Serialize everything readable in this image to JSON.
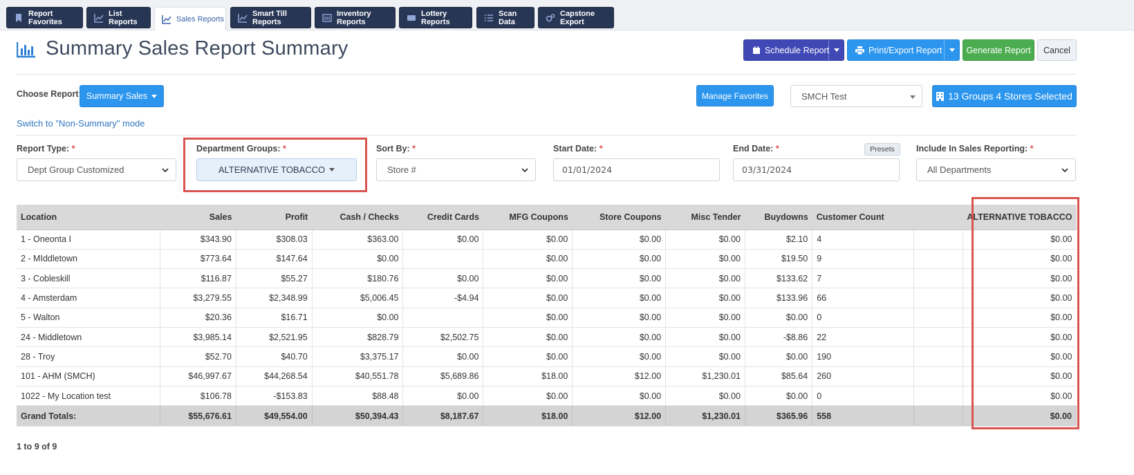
{
  "tabs": [
    {
      "label": "Report Favorites",
      "icon": "bookmark-icon",
      "active": false
    },
    {
      "label": "List Reports",
      "icon": "line-chart-icon",
      "active": false
    },
    {
      "label": "Sales Reports",
      "icon": "line-chart-icon",
      "active": true
    },
    {
      "label": "Smart Till Reports",
      "icon": "line-chart-icon",
      "active": false
    },
    {
      "label": "Inventory Reports",
      "icon": "inventory-icon",
      "active": false
    },
    {
      "label": "Lottery Reports",
      "icon": "ticket-icon",
      "active": false
    },
    {
      "label": "Scan Data",
      "icon": "list-icon",
      "active": false
    },
    {
      "label": "Capstone Export",
      "icon": "cogs-icon",
      "active": false
    }
  ],
  "header": {
    "title": "Summary Sales Report Summary",
    "icon": "bar-chart-icon",
    "schedule_label": "Schedule Report",
    "print_label": "Print/Export Report",
    "generate_label": "Generate Report",
    "cancel_label": "Cancel"
  },
  "controls": {
    "choose_report_label": "Choose Report",
    "choose_report_value": "Summary Sales",
    "switch_mode_link": "Switch to \"Non-Summary\" mode",
    "manage_favorites_label": "Manage Favorites",
    "store_select_value": "SMCH Test",
    "stores_selected_label": "13 Groups 4 Stores Selected"
  },
  "filters": {
    "report_type_label": "Report Type:",
    "report_type_value": "Dept Group Customized",
    "dept_groups_label": "Department Groups:",
    "dept_groups_value": "ALTERNATIVE TOBACCO",
    "sort_by_label": "Sort By:",
    "sort_by_value": "Store #",
    "start_date_label": "Start Date:",
    "start_date_value": "01/01/2024",
    "end_date_label": "End Date:",
    "end_date_value": "03/31/2024",
    "presets_label": "Presets",
    "include_label": "Include In Sales Reporting:",
    "include_value": "All Departments",
    "required_mark": "*"
  },
  "table": {
    "headers": [
      "Location",
      "Sales",
      "Profit",
      "Cash / Checks",
      "Credit Cards",
      "MFG Coupons",
      "Store Coupons",
      "Misc Tender",
      "Buydowns",
      "Customer Count",
      "",
      "ALTERNATIVE TOBACCO"
    ],
    "rows": [
      [
        "1 - Oneonta I",
        "$343.90",
        "$308.03",
        "$363.00",
        "$0.00",
        "$0.00",
        "$0.00",
        "$0.00",
        "$2.10",
        "4",
        "",
        "$0.00"
      ],
      [
        "2 - MIddletown",
        "$773.64",
        "$147.64",
        "$0.00",
        "",
        "$0.00",
        "$0.00",
        "$0.00",
        "$19.50",
        "9",
        "",
        "$0.00"
      ],
      [
        "3 - Cobleskill",
        "$116.87",
        "$55.27",
        "$180.76",
        "$0.00",
        "$0.00",
        "$0.00",
        "$0.00",
        "$133.62",
        "7",
        "",
        "$0.00"
      ],
      [
        "4 - Amsterdam",
        "$3,279.55",
        "$2,348.99",
        "$5,006.45",
        "-$4.94",
        "$0.00",
        "$0.00",
        "$0.00",
        "$133.96",
        "66",
        "",
        "$0.00"
      ],
      [
        "5 - Walton",
        "$20.36",
        "$16.71",
        "$0.00",
        "",
        "$0.00",
        "$0.00",
        "$0.00",
        "$0.00",
        "0",
        "",
        "$0.00"
      ],
      [
        "24 - Middletown",
        "$3,985.14",
        "$2,521.95",
        "$828.79",
        "$2,502.75",
        "$0.00",
        "$0.00",
        "$0.00",
        "-$8.86",
        "22",
        "",
        "$0.00"
      ],
      [
        "28 - Troy",
        "$52.70",
        "$40.70",
        "$3,375.17",
        "$0.00",
        "$0.00",
        "$0.00",
        "$0.00",
        "$0.00",
        "190",
        "",
        "$0.00"
      ],
      [
        "101 - AHM (SMCH)",
        "$46,997.67",
        "$44,268.54",
        "$40,551.78",
        "$5,689.86",
        "$18.00",
        "$12.00",
        "$1,230.01",
        "$85.64",
        "260",
        "",
        "$0.00"
      ],
      [
        "1022 - My Location test",
        "$106.78",
        "-$153.83",
        "$88.48",
        "$0.00",
        "$0.00",
        "$0.00",
        "$0.00",
        "$0.00",
        "0",
        "",
        "$0.00"
      ]
    ],
    "totals": [
      "Grand Totals:",
      "$55,676.61",
      "$49,554.00",
      "$50,394.43",
      "$8,187.67",
      "$18.00",
      "$12.00",
      "$1,230.01",
      "$365.96",
      "558",
      "",
      "$0.00"
    ]
  },
  "pager_text": "1 to 9 of 9",
  "colors": {
    "tab_bg": "#283655",
    "schedule_bg": "#3f48b5",
    "primary_blue": "#2c96ee",
    "generate_green": "#4cad50",
    "highlight_red": "#d9534f"
  }
}
